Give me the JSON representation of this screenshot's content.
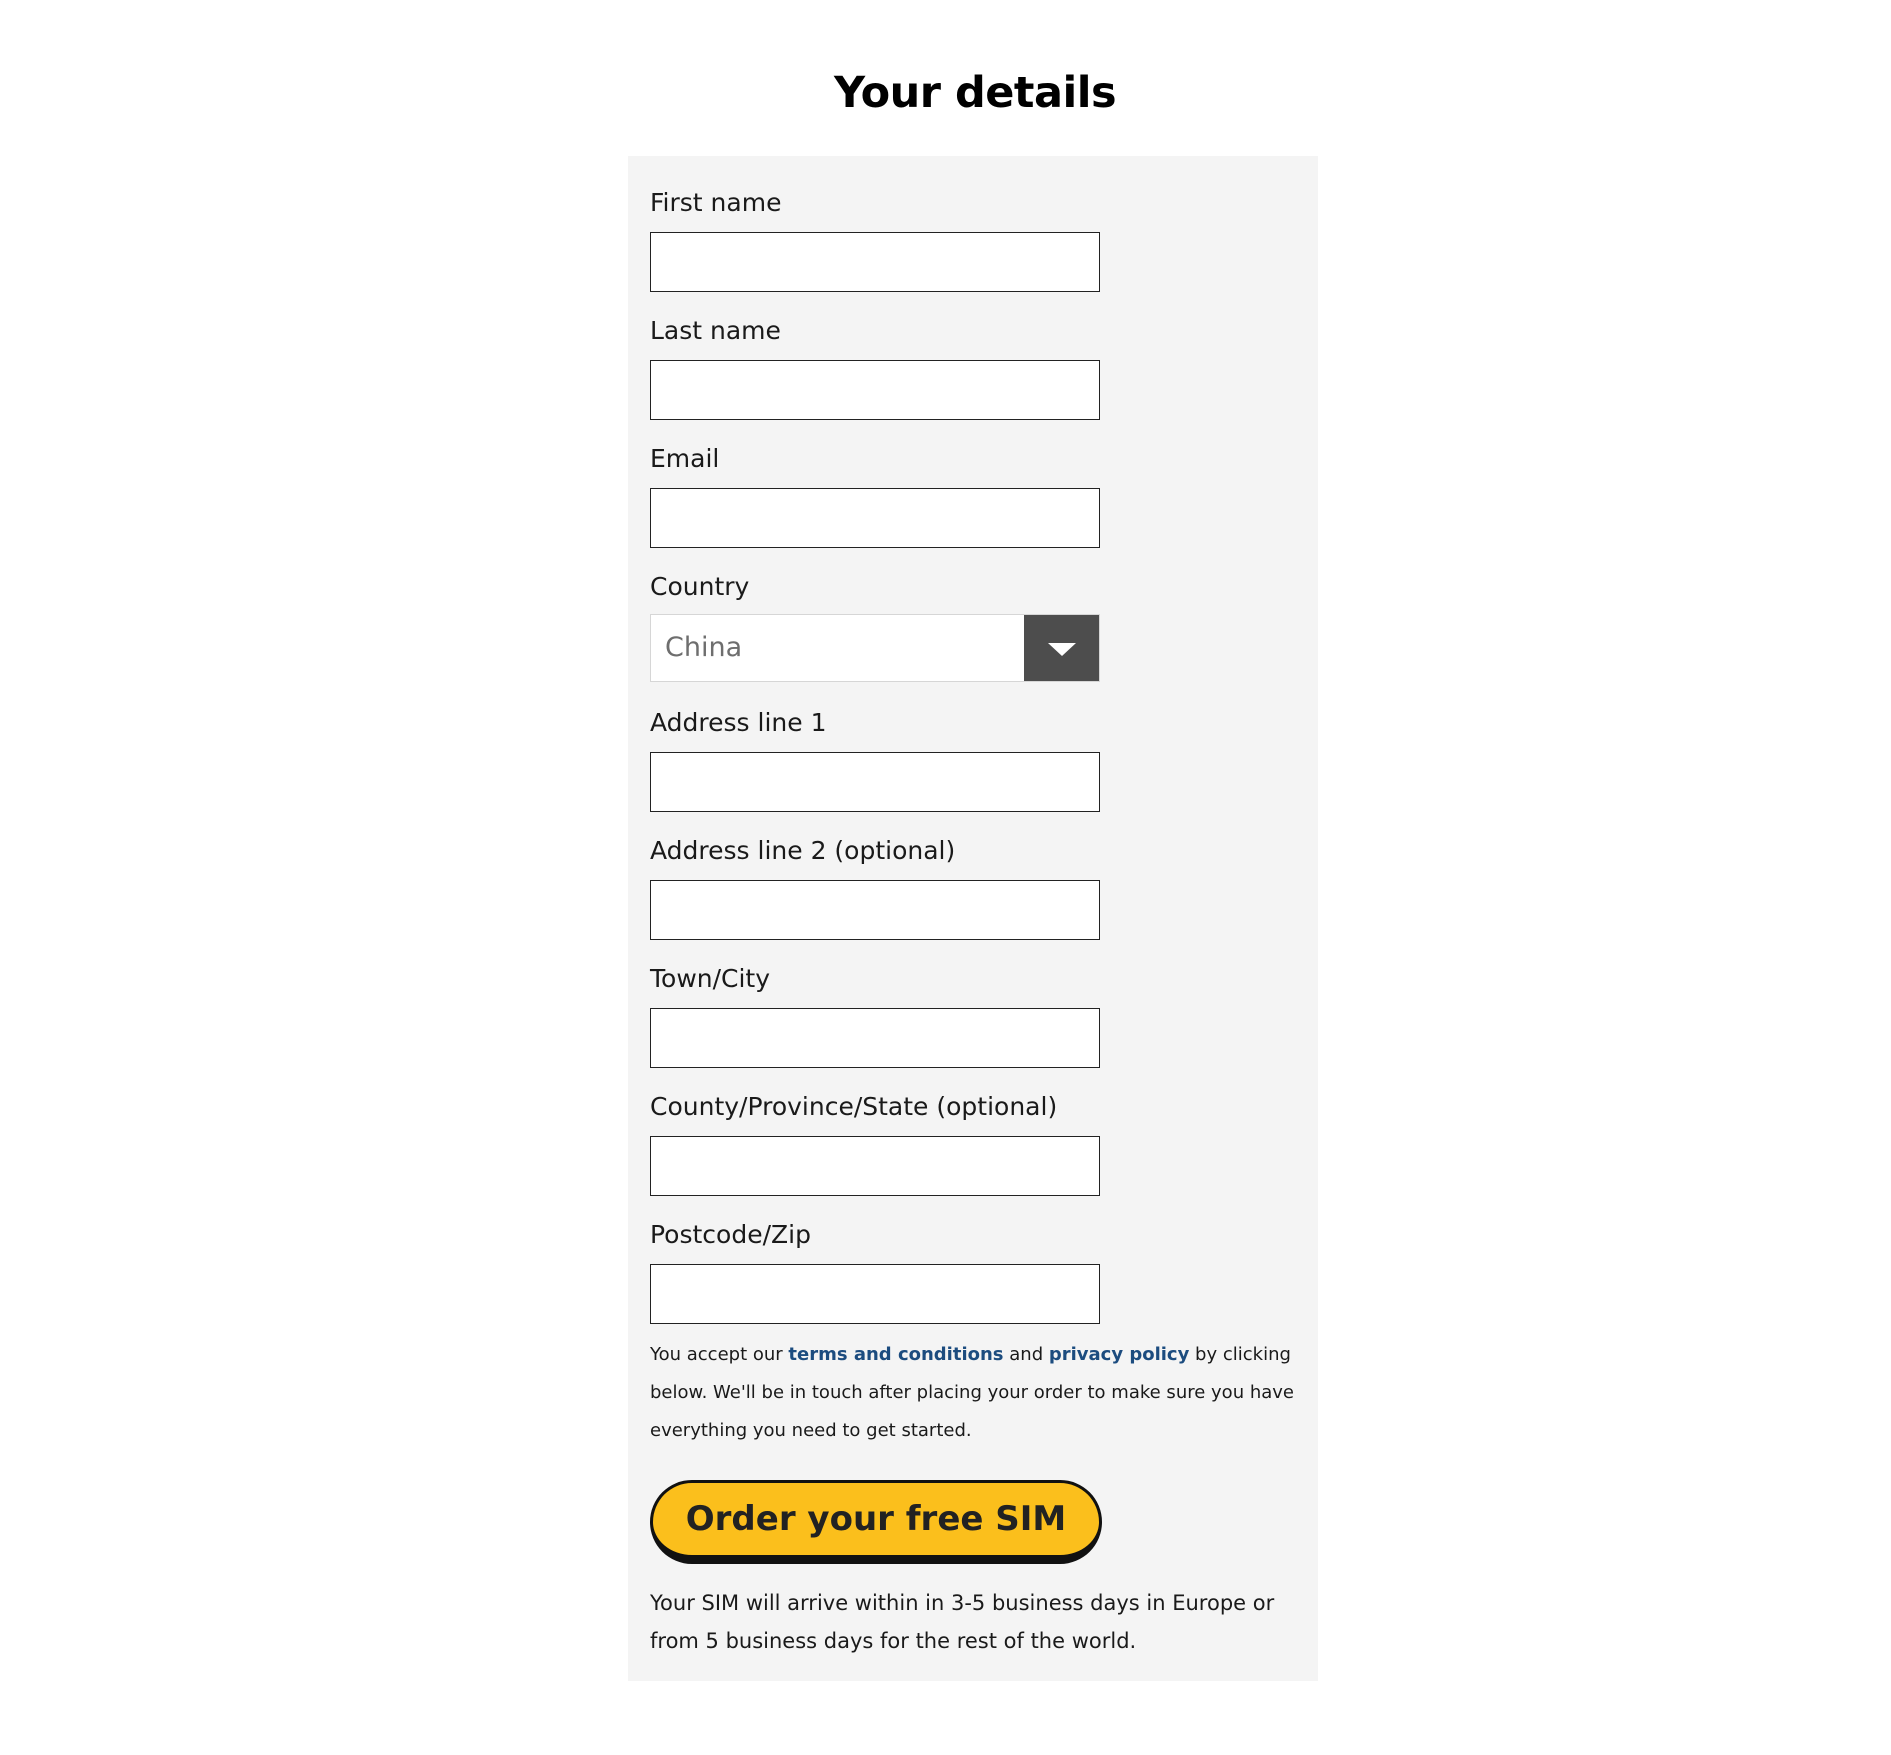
{
  "page": {
    "title": "Your details"
  },
  "form": {
    "fields": [
      {
        "label": "First name",
        "value": "",
        "placeholder": ""
      },
      {
        "label": "Last name",
        "value": "",
        "placeholder": ""
      },
      {
        "label": "Email",
        "value": "",
        "placeholder": ""
      },
      {
        "label": "Country",
        "value": "China"
      },
      {
        "label": "Address line 1",
        "value": "",
        "placeholder": ""
      },
      {
        "label": "Address line 2 (optional)",
        "value": "",
        "placeholder": ""
      },
      {
        "label": "Town/City",
        "value": "",
        "placeholder": ""
      },
      {
        "label": "County/Province/State (optional)",
        "value": "",
        "placeholder": ""
      },
      {
        "label": "Postcode/Zip",
        "value": "",
        "placeholder": ""
      }
    ],
    "country_dropdown_icon": "chevron-down-icon",
    "terms": {
      "prefix": "You accept our ",
      "terms_link": "terms and conditions",
      "middle": " and ",
      "privacy_link": "privacy policy",
      "suffix": " by clicking below. We'll be in touch after placing your order to make sure you have everything you need to get started."
    },
    "submit_label": "Order your free SIM",
    "shipping_note": "Your SIM will arrive within in 3-5 business days in Europe or from 5 business days for the rest of the world."
  },
  "colors": {
    "panel_background": "#f4f4f4",
    "button_background": "#fbbf1c",
    "link": "#1c4c7f",
    "select_arrow_background": "#4d4d4d"
  }
}
